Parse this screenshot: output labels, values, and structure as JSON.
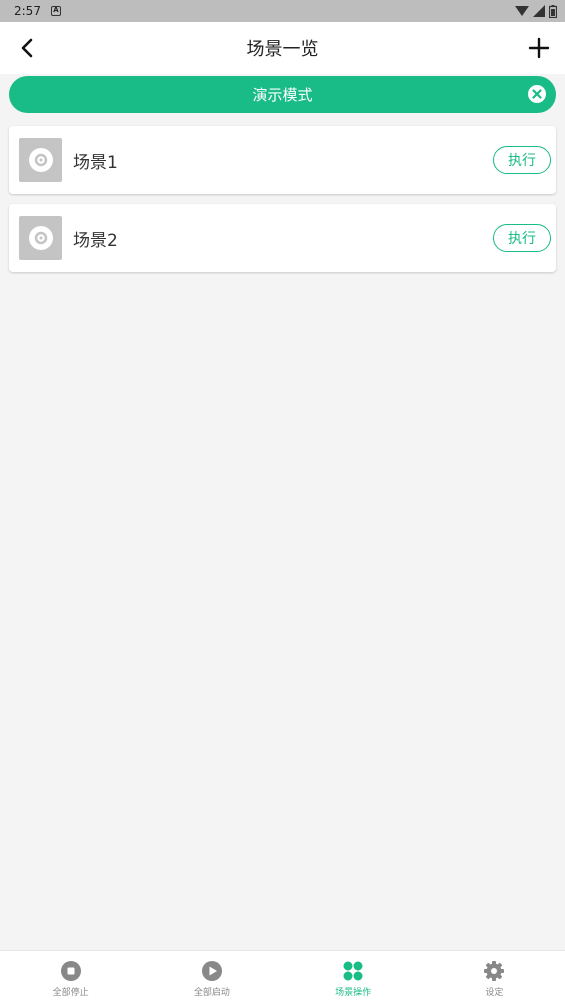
{
  "status_bar": {
    "time": "2:57"
  },
  "header": {
    "title": "场景一览"
  },
  "banner": {
    "label": "演示模式"
  },
  "scenes": [
    {
      "name": "场景1",
      "action": "执行"
    },
    {
      "name": "场景2",
      "action": "执行"
    }
  ],
  "bottom_nav": [
    {
      "label": "全部停止",
      "icon": "stop-icon",
      "active": false
    },
    {
      "label": "全部启动",
      "icon": "play-icon",
      "active": false
    },
    {
      "label": "场景操作",
      "icon": "scene-grid-icon",
      "active": true
    },
    {
      "label": "设定",
      "icon": "gear-icon",
      "active": false
    }
  ],
  "colors": {
    "accent": "#19bb86",
    "inactive": "#888888",
    "status_bar": "#bdbdbd"
  }
}
